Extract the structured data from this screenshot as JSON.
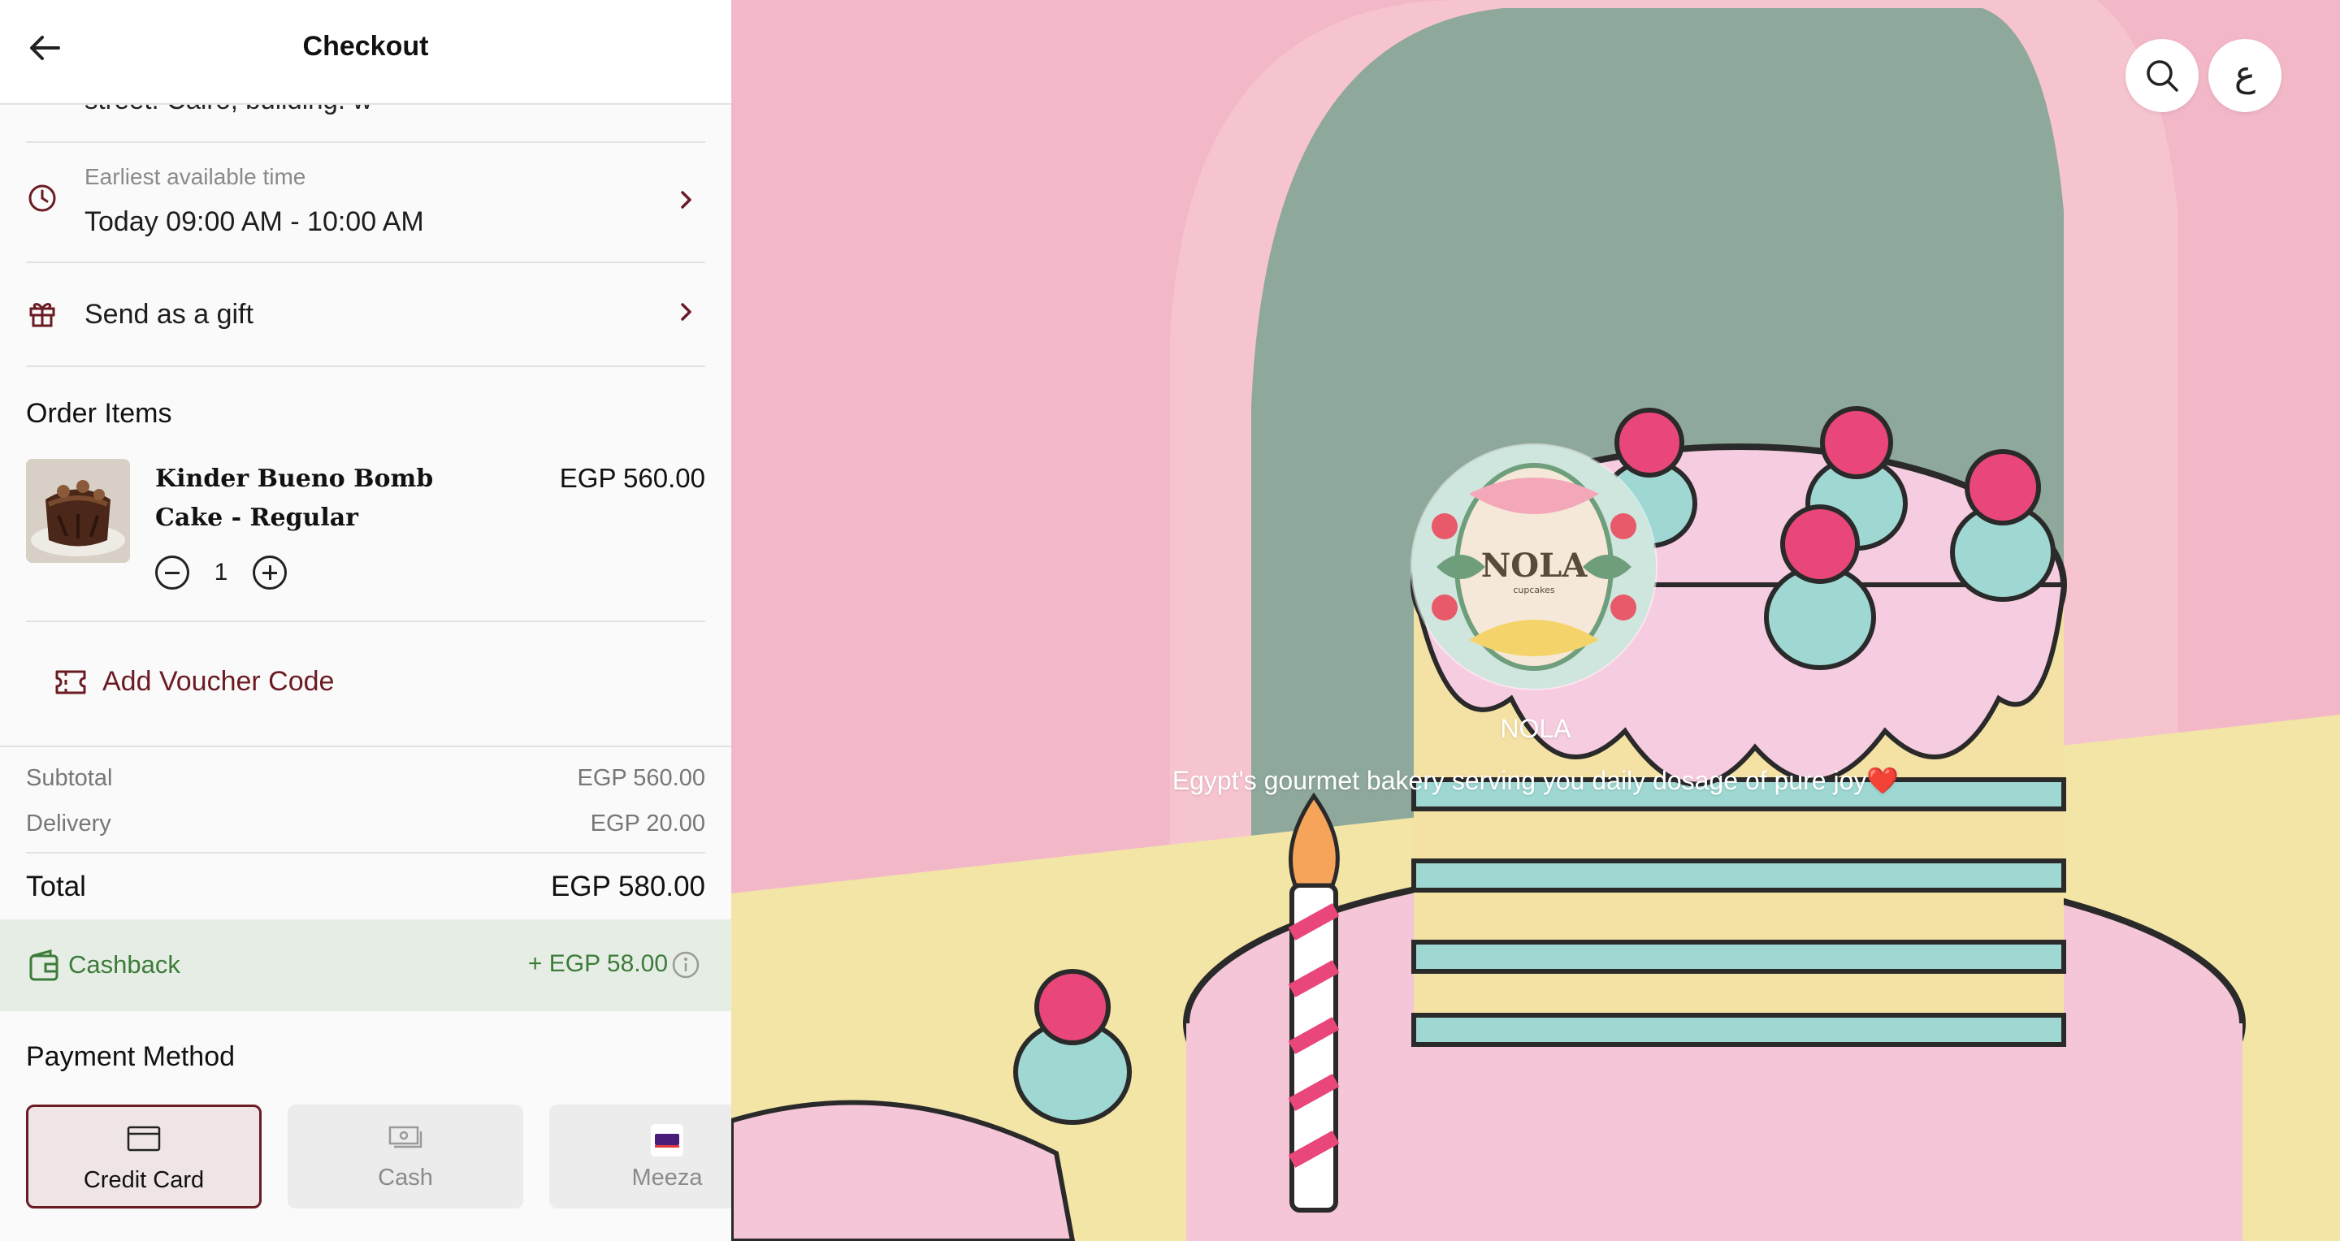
{
  "header": {
    "title": "Checkout"
  },
  "address": {
    "cut_text": "street: Cairo, building: w"
  },
  "delivery_time": {
    "label": "Earliest available time",
    "value": "Today 09:00 AM - 10:00 AM"
  },
  "gift": {
    "label": "Send as a gift"
  },
  "order_items": {
    "title": "Order Items",
    "items": [
      {
        "name": "Kinder Bueno Bomb Cake - Regular",
        "price": "EGP 560.00",
        "quantity": "1"
      }
    ]
  },
  "voucher": {
    "label": "Add Voucher Code"
  },
  "summary": {
    "subtotal_label": "Subtotal",
    "subtotal_value": "EGP 560.00",
    "delivery_label": "Delivery",
    "delivery_value": "EGP 20.00",
    "total_label": "Total",
    "total_value": "EGP 580.00"
  },
  "cashback": {
    "label": "Cashback",
    "value": "+ EGP 58.00"
  },
  "payment": {
    "title": "Payment Method",
    "methods": [
      {
        "label": "Credit Card",
        "icon": "credit-card-icon",
        "selected": true
      },
      {
        "label": "Cash",
        "icon": "cash-icon",
        "selected": false
      },
      {
        "label": "Meeza",
        "icon": "meeza-logo",
        "selected": false
      }
    ]
  },
  "store": {
    "name": "NOLA",
    "logo_text": "NOLA",
    "logo_subtext": "cupcakes",
    "tagline": "Egypt's gourmet bakery serving you daily dosage of pure joy❤️"
  },
  "top_actions": {
    "language_label": "ع"
  },
  "colors": {
    "accent": "#6b1b22",
    "cashback_green": "#3c7c3a",
    "cashback_bg": "#e6ede4"
  }
}
